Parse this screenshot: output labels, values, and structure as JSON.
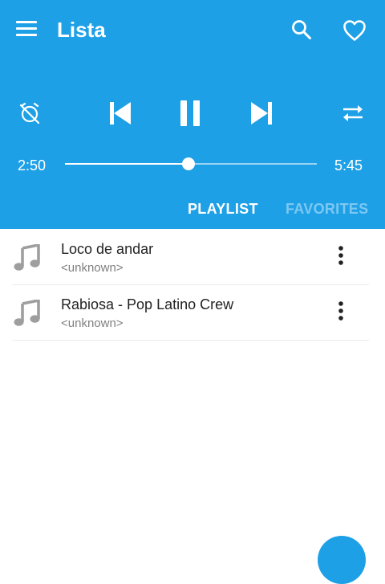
{
  "app": {
    "title": "Lista"
  },
  "icons": {
    "menu": "menu-icon",
    "search": "search-icon",
    "favorite": "heart-outline-icon",
    "sleep_timer": "alarm-off-icon",
    "previous": "skip-previous-icon",
    "play_pause": "pause-icon",
    "next": "skip-next-icon",
    "repeat": "repeat-icon",
    "track": "music-note-icon",
    "more": "more-vert-icon"
  },
  "player": {
    "elapsed": "2:50",
    "duration": "5:45",
    "progress": 0.49
  },
  "tabs": [
    {
      "label": "PLAYLIST",
      "active": true
    },
    {
      "label": "FAVORITES",
      "active": false
    }
  ],
  "playlist": [
    {
      "title": "Loco de andar",
      "artist": "<unknown>"
    },
    {
      "title": "Rabiosa - Pop Latino Crew",
      "artist": "<unknown>"
    }
  ],
  "colors": {
    "accent": "#1ea0e6",
    "tab_active": "#ffffff",
    "tab_inactive": "#7cc8f2",
    "title_text": "#222222",
    "subtitle_text": "#808080",
    "note_icon": "#9e9e9e"
  }
}
